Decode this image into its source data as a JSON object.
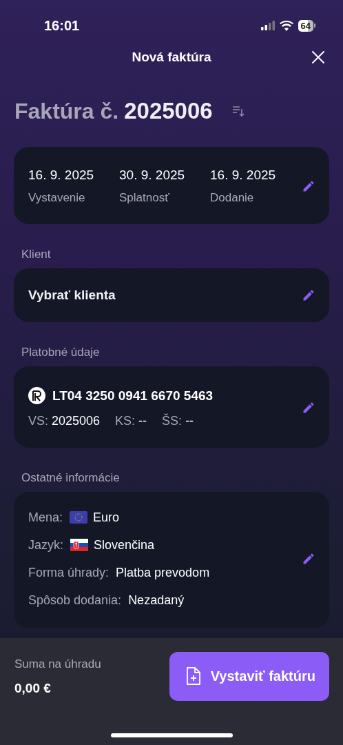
{
  "status_bar": {
    "time": "16:01",
    "battery": "64"
  },
  "header": {
    "title": "Nová faktúra"
  },
  "invoice_title": {
    "label": "Faktúra č.",
    "number": "2025006"
  },
  "dates": [
    {
      "value": "16. 9. 2025",
      "label": "Vystavenie"
    },
    {
      "value": "30. 9. 2025",
      "label": "Splatnosť"
    },
    {
      "value": "16. 9. 2025",
      "label": "Dodanie"
    }
  ],
  "client": {
    "section": "Klient",
    "value": "Vybrať klienta"
  },
  "payment": {
    "section": "Platobné údaje",
    "iban": "LT04 3250 0941 6670 5463",
    "symbols": [
      {
        "label": "VS:",
        "value": "2025006"
      },
      {
        "label": "KS:",
        "value": "--"
      },
      {
        "label": "ŠS:",
        "value": "--"
      }
    ]
  },
  "other": {
    "section": "Ostatné informácie",
    "rows": [
      {
        "kind": "euflag",
        "label": "Mena:",
        "value": "Euro"
      },
      {
        "kind": "skflag",
        "label": "Jazyk:",
        "value": "Slovenčina"
      },
      {
        "kind": "plain",
        "label": "Forma úhrady:",
        "value": "Platba prevodom"
      },
      {
        "kind": "plain",
        "label": "Spôsob dodania:",
        "value": "Nezadaný"
      }
    ]
  },
  "footer": {
    "total_label": "Suma na úhradu",
    "total": "0,00 €",
    "button": "Vystaviť faktúru"
  }
}
